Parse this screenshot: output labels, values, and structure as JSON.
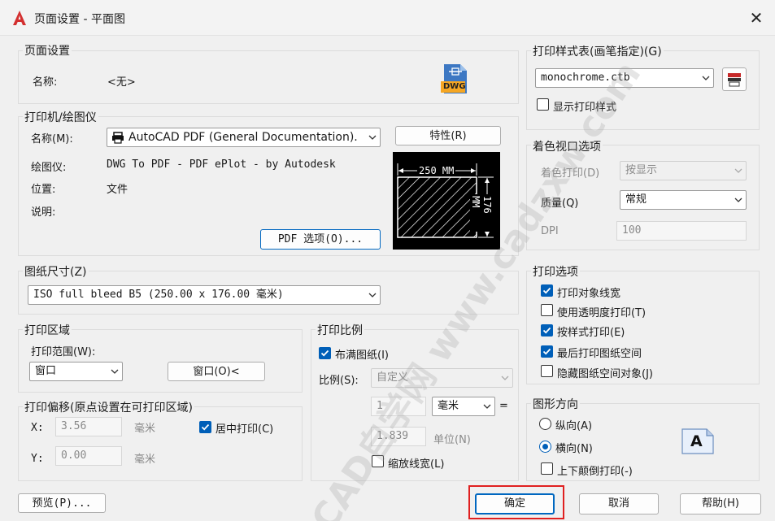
{
  "window": {
    "title": "页面设置 - 平面图",
    "close": "✕"
  },
  "page_setup": {
    "title": "页面设置",
    "name_label": "名称:",
    "name_value": "<无>",
    "dwg_icon_text": "DWG"
  },
  "plotter": {
    "title": "打印机/绘图仪",
    "name_label": "名称(M):",
    "name_value": "AutoCAD PDF (General Documentation).",
    "properties_button": "特性(R)",
    "plotter_label": "绘图仪:",
    "plotter_value": "DWG To PDF - PDF ePlot - by Autodesk",
    "location_label": "位置:",
    "location_value": "文件",
    "description_label": "说明:",
    "pdf_options_button": "PDF 选项(O)...",
    "preview_width": "250 MM",
    "preview_height": "176 MM"
  },
  "paper_size": {
    "title": "图纸尺寸(Z)",
    "value": "ISO full bleed B5 (250.00 x 176.00 毫米)"
  },
  "plot_area": {
    "title": "打印区域",
    "range_label": "打印范围(W):",
    "range_value": "窗口",
    "window_button": "窗口(O)<"
  },
  "plot_offset": {
    "title": "打印偏移(原点设置在可打印区域)",
    "x_label": "X:",
    "x_value": "3.56",
    "x_unit": "毫米",
    "y_label": "Y:",
    "y_value": "0.00",
    "y_unit": "毫米",
    "center_label": "居中打印(C)",
    "center_checked": true
  },
  "plot_scale": {
    "title": "打印比例",
    "fit_label": "布满图纸(I)",
    "fit_checked": true,
    "scale_label": "比例(S):",
    "scale_value": "自定义",
    "num_value": "1",
    "unit_value": "毫米",
    "equals": "=",
    "den_value": "1.839",
    "den_unit": "单位(N)",
    "lineweight_label": "缩放线宽(L)",
    "lineweight_checked": false
  },
  "plot_style_table": {
    "title": "打印样式表(画笔指定)(G)",
    "value": "monochrome.ctb",
    "show_label": "显示打印样式",
    "show_checked": false
  },
  "shaded_viewport": {
    "title": "着色视口选项",
    "shade_label": "着色打印(D)",
    "shade_value": "按显示",
    "quality_label": "质量(Q)",
    "quality_value": "常规",
    "dpi_label": "DPI",
    "dpi_value": "100"
  },
  "plot_options": {
    "title": "打印选项",
    "items": [
      {
        "label": "打印对象线宽",
        "checked": true
      },
      {
        "label": "使用透明度打印(T)",
        "checked": false
      },
      {
        "label": "按样式打印(E)",
        "checked": true
      },
      {
        "label": "最后打印图纸空间",
        "checked": true
      },
      {
        "label": "隐藏图纸空间对象(J)",
        "checked": false
      }
    ]
  },
  "orientation": {
    "title": "图形方向",
    "portrait": "纵向(A)",
    "landscape": "横向(N)",
    "landscape_selected": true,
    "upside_down": "上下颠倒打印(-)",
    "upside_down_checked": false,
    "icon_letter": "A"
  },
  "footer": {
    "preview": "预览(P)...",
    "ok": "确定",
    "cancel": "取消",
    "help": "帮助(H)"
  },
  "watermark": "CAD自学网 www.cadzxw.com",
  "colors": {
    "accent": "#005fb8",
    "highlight_frame": "#e02020"
  }
}
